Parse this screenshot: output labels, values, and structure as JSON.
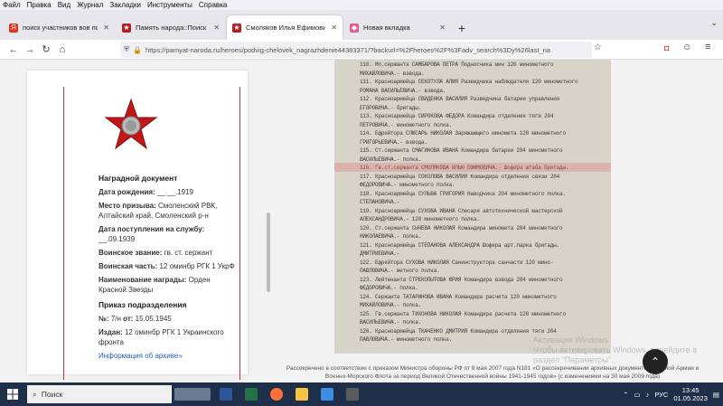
{
  "menu": [
    "Файл",
    "Правка",
    "Вид",
    "Журнал",
    "Закладки",
    "Инструменты",
    "Справка"
  ],
  "tabs": [
    {
      "label": "поиск участников вов по фам",
      "icon_color": "#e0341c",
      "icon": "Я",
      "active": false
    },
    {
      "label": "Память народа::Поиск докум",
      "icon_color": "#b02020",
      "icon": "★",
      "active": false
    },
    {
      "label": "Смоляков Илья Ефимович : П",
      "icon_color": "#b02020",
      "icon": "★",
      "active": true
    },
    {
      "label": "Новая вкладка",
      "icon_color": "#e85a8a",
      "icon": "◆",
      "active": false
    }
  ],
  "nav": {
    "back": "←",
    "forward": "→",
    "reload": "↻",
    "home": "⌂"
  },
  "url": "https://pamyat-naroda.ru/heroes/podvig-chelovek_nagrazhdenie44383371/?backurl=%2Fheroes%2F%3Fadv_search%3Dy%26last_na",
  "card": {
    "section1_title": "Наградной документ",
    "rows": [
      {
        "k": "Дата рождения:",
        "v": "__.__.1919"
      },
      {
        "k": "Место призыва:",
        "v": "Смоленский РВК, Алтайский край, Смоленский р-н"
      },
      {
        "k": "Дата поступления на службу:",
        "v": "__.09.1939"
      },
      {
        "k": "Воинское звание:",
        "v": "гв. ст. сержант"
      },
      {
        "k": "Воинская часть:",
        "v": "12 оминбр РГК 1 УкрФ"
      },
      {
        "k": "Наименование награды:",
        "v": "Орден Красной Звезды"
      }
    ],
    "section2_title": "Приказ подразделения",
    "rows2": [
      {
        "k": "№:",
        "v": "7/н",
        "k2": "от:",
        "v2": "15.05.1945"
      },
      {
        "k": "Издан:",
        "v": "12 оминбр РГК 1 Украинского фронта"
      }
    ],
    "archive_link": "Информация об архиве»"
  },
  "doc_lines": [
    "110. Мл.сержанта САМБАРОВА ПЕТРА              Подносчика мин 120 минометного",
    "     МИХАЙЛОВИЧА.-                             взвода.",
    "111. Красноармейца СЕКОТУЛА АЛИЯ               Разведчика наблюдателя 120 минометного",
    "     РОМАНА ВАСИЛЬЕВИЧА.-                      взвода.",
    "112. Красноармейца СВИДЕНКА ВАСИЛИЯ             Разведчика батареи управления",
    "     ЕГОРОВИЧА.-                               бригады.",
    "113. Красноармейца СИРОКОВА ФЕДОРА             Командира отделения тяги 204",
    "     ПЕТРОВИЧА.-                               минометного полка.",
    "114. Ефрейтора СЛЮСАРЬ НИКОЛАЯ                 Заряжающего миномета 120 минометного",
    "     ГРИГОРЬЕВИЧА.-                            взвода.",
    "115. Ст.сержанта СМАГИНОВА ИВАНА               Командира батареи 204 минометного",
    "     ВАСИЛЬЕВИЧА.-                             полка.",
    "116. Гв.ст.сержанта СМОЛЯКОВА ИЛЬЮ ЕФИМОВИЧА.- Шофера штаба бригады.",
    "117. Красноармейца СОКОЛОВА ВАСИЛИЯ            Командира отделения связи 204",
    "     ФЕДОРОВИЧА.-                              минометного полка.",
    "118. Красноармейца СУЛЬВА ГРИГОРИЯ             Наводчика 204 минометного полка.",
    "     СТЕПАНОВИЧА.-",
    "119. Красноармейца СУХОВА ИВАНА                Слесаря автотехнической мастерской",
    "     АЛЕКСАНДРОВИЧА.-                          120 минометного полка.",
    "120. Ст.сержанта СЫЧЕВА НИКОЛАЯ                Командира миномета 204 минометного",
    "     НИКОЛАЕВИЧА.-                             полка.",
    "121. Красноармейца СТЕПАНОВА АЛЕКСАНДРА        Шофера арт.парка бригады.",
    "     ДМИТРИЕВИЧА.-",
    "122. Ефрейтора СУХОВА НИКОЛАЯ                  Санинструктора санчасти 120 мино-",
    "     ПАВЛОВИЧА.-                               метного полка.",
    "123. Лейтенанта СТРЕКОПЫТОВА ЮРИЯ              Командира взвода 204 минометного",
    "     ФЕДОРОВИЧА.-                              полка.",
    "124. Сержанта ТАТАРИНОВА ИВАНА                 Командира расчета 120 минометного",
    "     МИХАЙЛОВИЧА.-                             полка.",
    "125. Гв.сержанта ТИХОНОВА НИКОЛАЯ              Командира расчета 120 минометного",
    "     ВАСИЛЬЕВИЧА.-                             полка.",
    "126. Красноармейца ТКАЧЕНКО ДМИТРИЯ            Командира отделения тяги 204",
    "     ПАВЛОВИЧА.-                               минометного полка."
  ],
  "caption": "Рассекречено в соответствии с приказом Министра обороны РФ от 8 мая 2007 года N181 «О рассекречивании архивных документов Красной Армии и Военно-Морского Флота за период Великой Отечественной войны 1941-1945 годов» (с изменениями на 30 мая 2009 года)",
  "watermark": {
    "line1": "Активация Windows",
    "line2": "Чтобы активировать Windows, перейдите в",
    "line3": "раздел \"Параметры\"."
  },
  "taskbar": {
    "search_placeholder": "Поиск",
    "lang": "РУС",
    "time": "13:45",
    "date": "01.05.2023"
  }
}
